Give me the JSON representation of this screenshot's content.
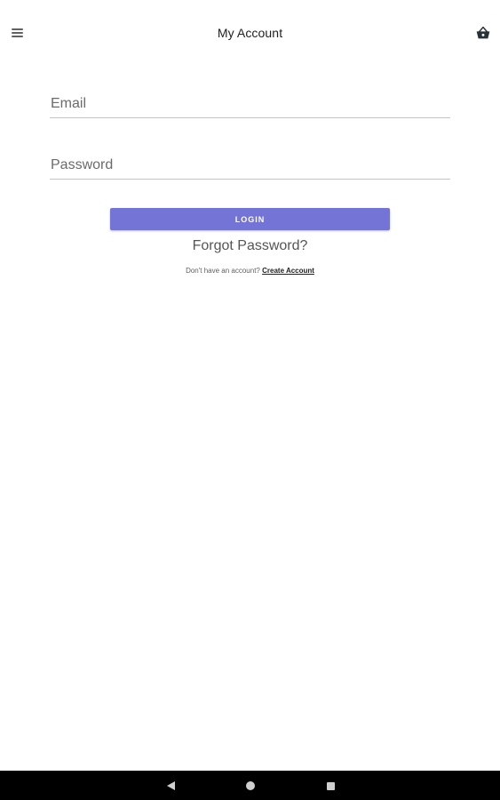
{
  "appbar": {
    "title": "My Account",
    "menu_icon": "hamburger-menu-icon",
    "cart_icon": "shopping-basket-icon"
  },
  "form": {
    "email_placeholder": "Email",
    "email_value": "",
    "password_placeholder": "Password",
    "password_value": "",
    "login_label": "LOGIN",
    "forgot_label": "Forgot Password?",
    "signup_prompt": "Don't have an account?",
    "signup_link": "Create Account"
  },
  "navbar": {
    "back_icon": "back-triangle-icon",
    "home_icon": "home-circle-icon",
    "recents_icon": "recents-square-icon"
  },
  "colors": {
    "accent": "#7474d6",
    "navbar_bg": "#000000"
  }
}
